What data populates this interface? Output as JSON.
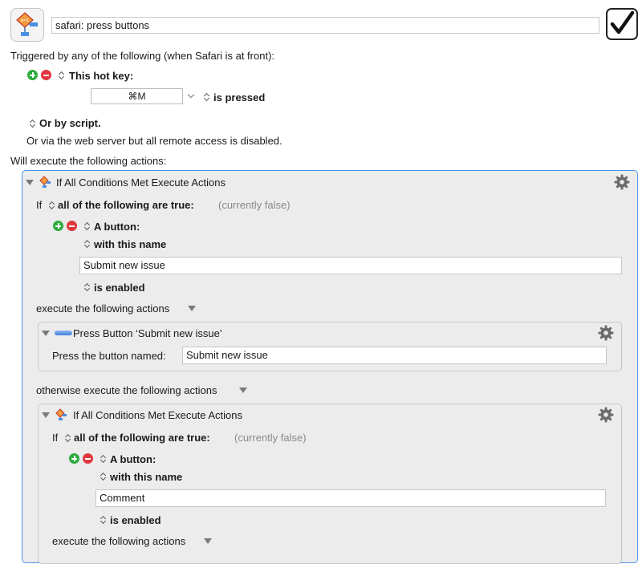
{
  "macro": {
    "name": "safari: press buttons",
    "icon": "if-then-else-icon",
    "enabled_icon": "checkmark-icon"
  },
  "triggers": {
    "heading": "Triggered by any of the following (when Safari is at front):",
    "hot_key_label": "This hot key:",
    "hot_key_value": "⌘M",
    "hot_key_condition": "is pressed",
    "or_by_script": "Or by script.",
    "web_server_note": "Or via the web server but all remote access is disabled."
  },
  "actions_heading": "Will execute the following actions:",
  "outer_if": {
    "title": "If All Conditions Met Execute Actions",
    "if_word": "If",
    "condition_mode": "all of the following are true:",
    "status": "(currently false)",
    "condition_type": "A button:",
    "name_mode": "with this name",
    "button_name": "Submit new issue",
    "state": "is enabled",
    "execute_label": "execute the following actions",
    "otherwise_label": "otherwise execute the following actions"
  },
  "press_button_action": {
    "title": "Press Button ‘Submit new issue’",
    "field_label": "Press the button named:",
    "field_value": "Submit new issue"
  },
  "inner_if": {
    "title": "If All Conditions Met Execute Actions",
    "if_word": "If",
    "condition_mode": "all of the following are true:",
    "status": "(currently false)",
    "condition_type": "A button:",
    "name_mode": "with this name",
    "button_name": "Comment",
    "state": "is enabled",
    "execute_label": "execute the following actions"
  },
  "colors": {
    "accent_border": "#4a90e2",
    "add_green": "#2eab3e",
    "remove_red": "#e0383e",
    "panel_bg": "#ececec"
  }
}
